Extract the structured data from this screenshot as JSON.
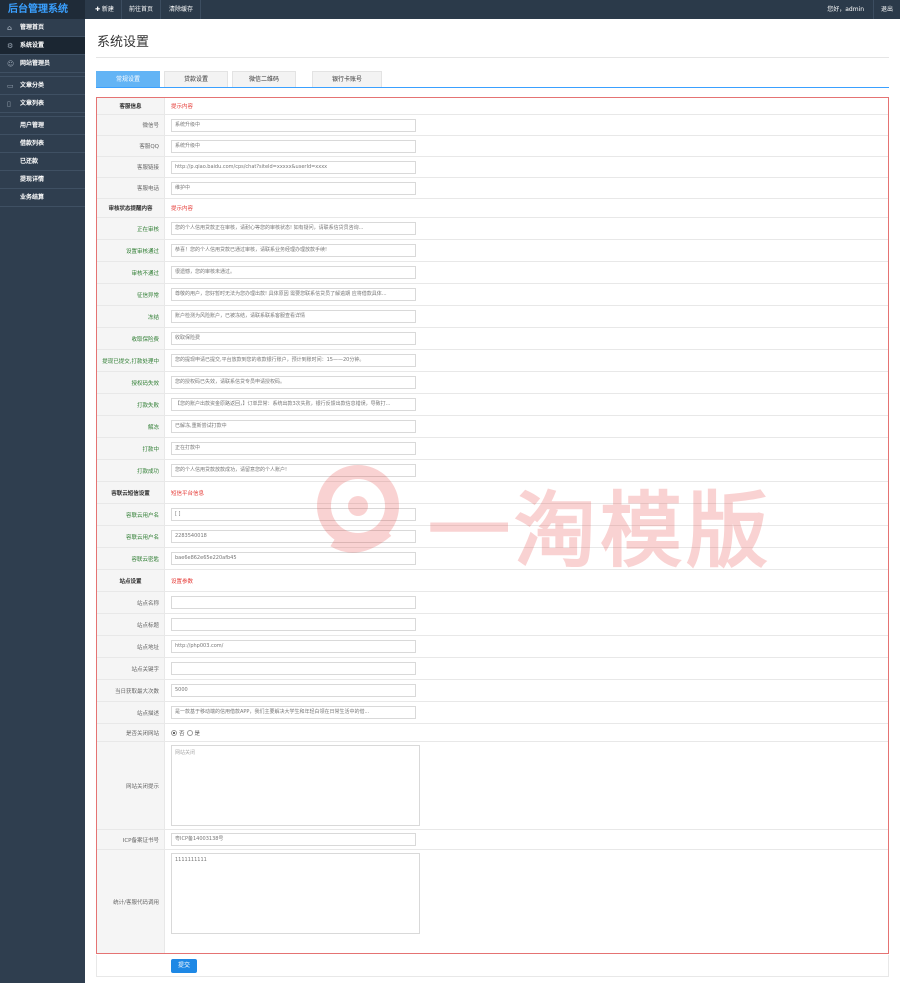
{
  "app": {
    "logo": "后台管理系统",
    "new_btn": "✚ 新建",
    "home_btn": "前往首页",
    "clear_cache_btn": "清除缓存",
    "greeting": "您好，admin",
    "logout": "退出"
  },
  "sidebar": {
    "items": [
      {
        "label": "管理首页",
        "icon": "home-icon"
      },
      {
        "label": "系统设置",
        "icon": "gear-icon"
      },
      {
        "label": "网站管理员",
        "icon": "user-icon"
      },
      {
        "label": "文章分类",
        "icon": "folder-icon"
      },
      {
        "label": "文章列表",
        "icon": "document-icon"
      },
      {
        "label": "用户管理",
        "icon": ""
      },
      {
        "label": "借款列表",
        "icon": ""
      },
      {
        "label": "已还款",
        "icon": ""
      },
      {
        "label": "提现详情",
        "icon": ""
      },
      {
        "label": "业务结算",
        "icon": ""
      }
    ]
  },
  "page": {
    "title": "系统设置"
  },
  "tabs": [
    "常规设置",
    "贷款设置",
    "微信二维码",
    "银行卡账号"
  ],
  "form": {
    "sec1": {
      "label": "客服信息",
      "note": "提示内容"
    },
    "wechat": {
      "label": "微信号",
      "value": "系统升级中"
    },
    "qq": {
      "label": "客服QQ",
      "value": "系统升级中"
    },
    "link": {
      "label": "客服链接",
      "value": "http://p.qiao.baidu.com/cps/chat?siteId=xxxxx&userId=xxxx"
    },
    "phone": {
      "label": "客服电话",
      "value": "维护中"
    },
    "sec2": {
      "label": "审核状态提醒内容",
      "note": "提示内容"
    },
    "reviewing": {
      "label": "正在审核",
      "value": "您的个人信用贷款正在审核，请耐心等您的审核状态! 如有疑问，请联系信贷员咨询..."
    },
    "approved": {
      "label": "设置审核通过",
      "value": "恭喜！您的个人信用贷款已通过审核，请联系业务经理办理放款手续!"
    },
    "rejected": {
      "label": "审核不通过",
      "value": "很遗憾，您的审核未通过。"
    },
    "credit_abnormal": {
      "label": "征信异常",
      "value": "尊敬的用户，您好暂时无法为您办理出款! 具体原因 需要您联系信贷员了解逾期 应将借款具体..."
    },
    "frozen": {
      "label": "冻结",
      "value": "账户检测为风险账户，已被冻结，请联系联系客服查看详情"
    },
    "insurance": {
      "label": "收取保险费",
      "value": "收取保险费"
    },
    "withdraw_processing": {
      "label": "提现已提交,打款处理中",
      "value": "您的提现申请已提交,平台放款到您的收款银行账户，预计到账时间：15——20分钟。"
    },
    "auth_failed": {
      "label": "授权码失效",
      "value": "您的授权码已失效，请联系信贷专员申请授权码。"
    },
    "pay_failed": {
      "label": "打款失败",
      "value": "【您的账户出款资金原路返回，】订单异常：系统出款3次失败，银行反馈出款信息错误，导致打..."
    },
    "unfreeze": {
      "label": "解冻",
      "value": "已解冻,重新尝试打款中"
    },
    "paying": {
      "label": "打款中",
      "value": "正在打款中"
    },
    "pay_success": {
      "label": "打款成功",
      "value": "您的个人信用贷款放款成功，请留意您的个人账户!"
    },
    "sec3": {
      "label": "容联云短信设置",
      "note": "短信平台信息"
    },
    "sms_user1": {
      "label": "容联云用户名",
      "value": "[  ]"
    },
    "sms_user2": {
      "label": "容联云用户名",
      "value": "2283540018"
    },
    "sms_key": {
      "label": "容联云密匙",
      "value": "bae6e862e65e220afb45"
    },
    "sec4": {
      "label": "站点设置",
      "note": "设置参数"
    },
    "site_name": {
      "label": "站点名称",
      "value": ""
    },
    "site_title": {
      "label": "站点标题",
      "value": ""
    },
    "site_url": {
      "label": "站点地址",
      "value": "http://php003.com/"
    },
    "site_keywords": {
      "label": "站点关键字",
      "value": ""
    },
    "daily_max": {
      "label": "当日获取最大次数",
      "value": "5000"
    },
    "site_desc": {
      "label": "站点描述",
      "value": "        是一款基于移动端的信用借款APP，我们主要解决大学生和年轻白领在日常生活中的借..."
    },
    "site_close": {
      "label": "是否关闭网站",
      "opt_no": "否",
      "opt_yes": "是"
    },
    "close_tip": {
      "label": "网站关闭提示",
      "placeholder": "网站关闭"
    },
    "icp": {
      "label": "ICP备案证书号",
      "value": "粤ICP备14003138号"
    },
    "stats": {
      "label": "统计/客服代码调用",
      "value": "1111111111"
    },
    "submit": "提交"
  },
  "watermark": {
    "text": "一淘模版"
  }
}
